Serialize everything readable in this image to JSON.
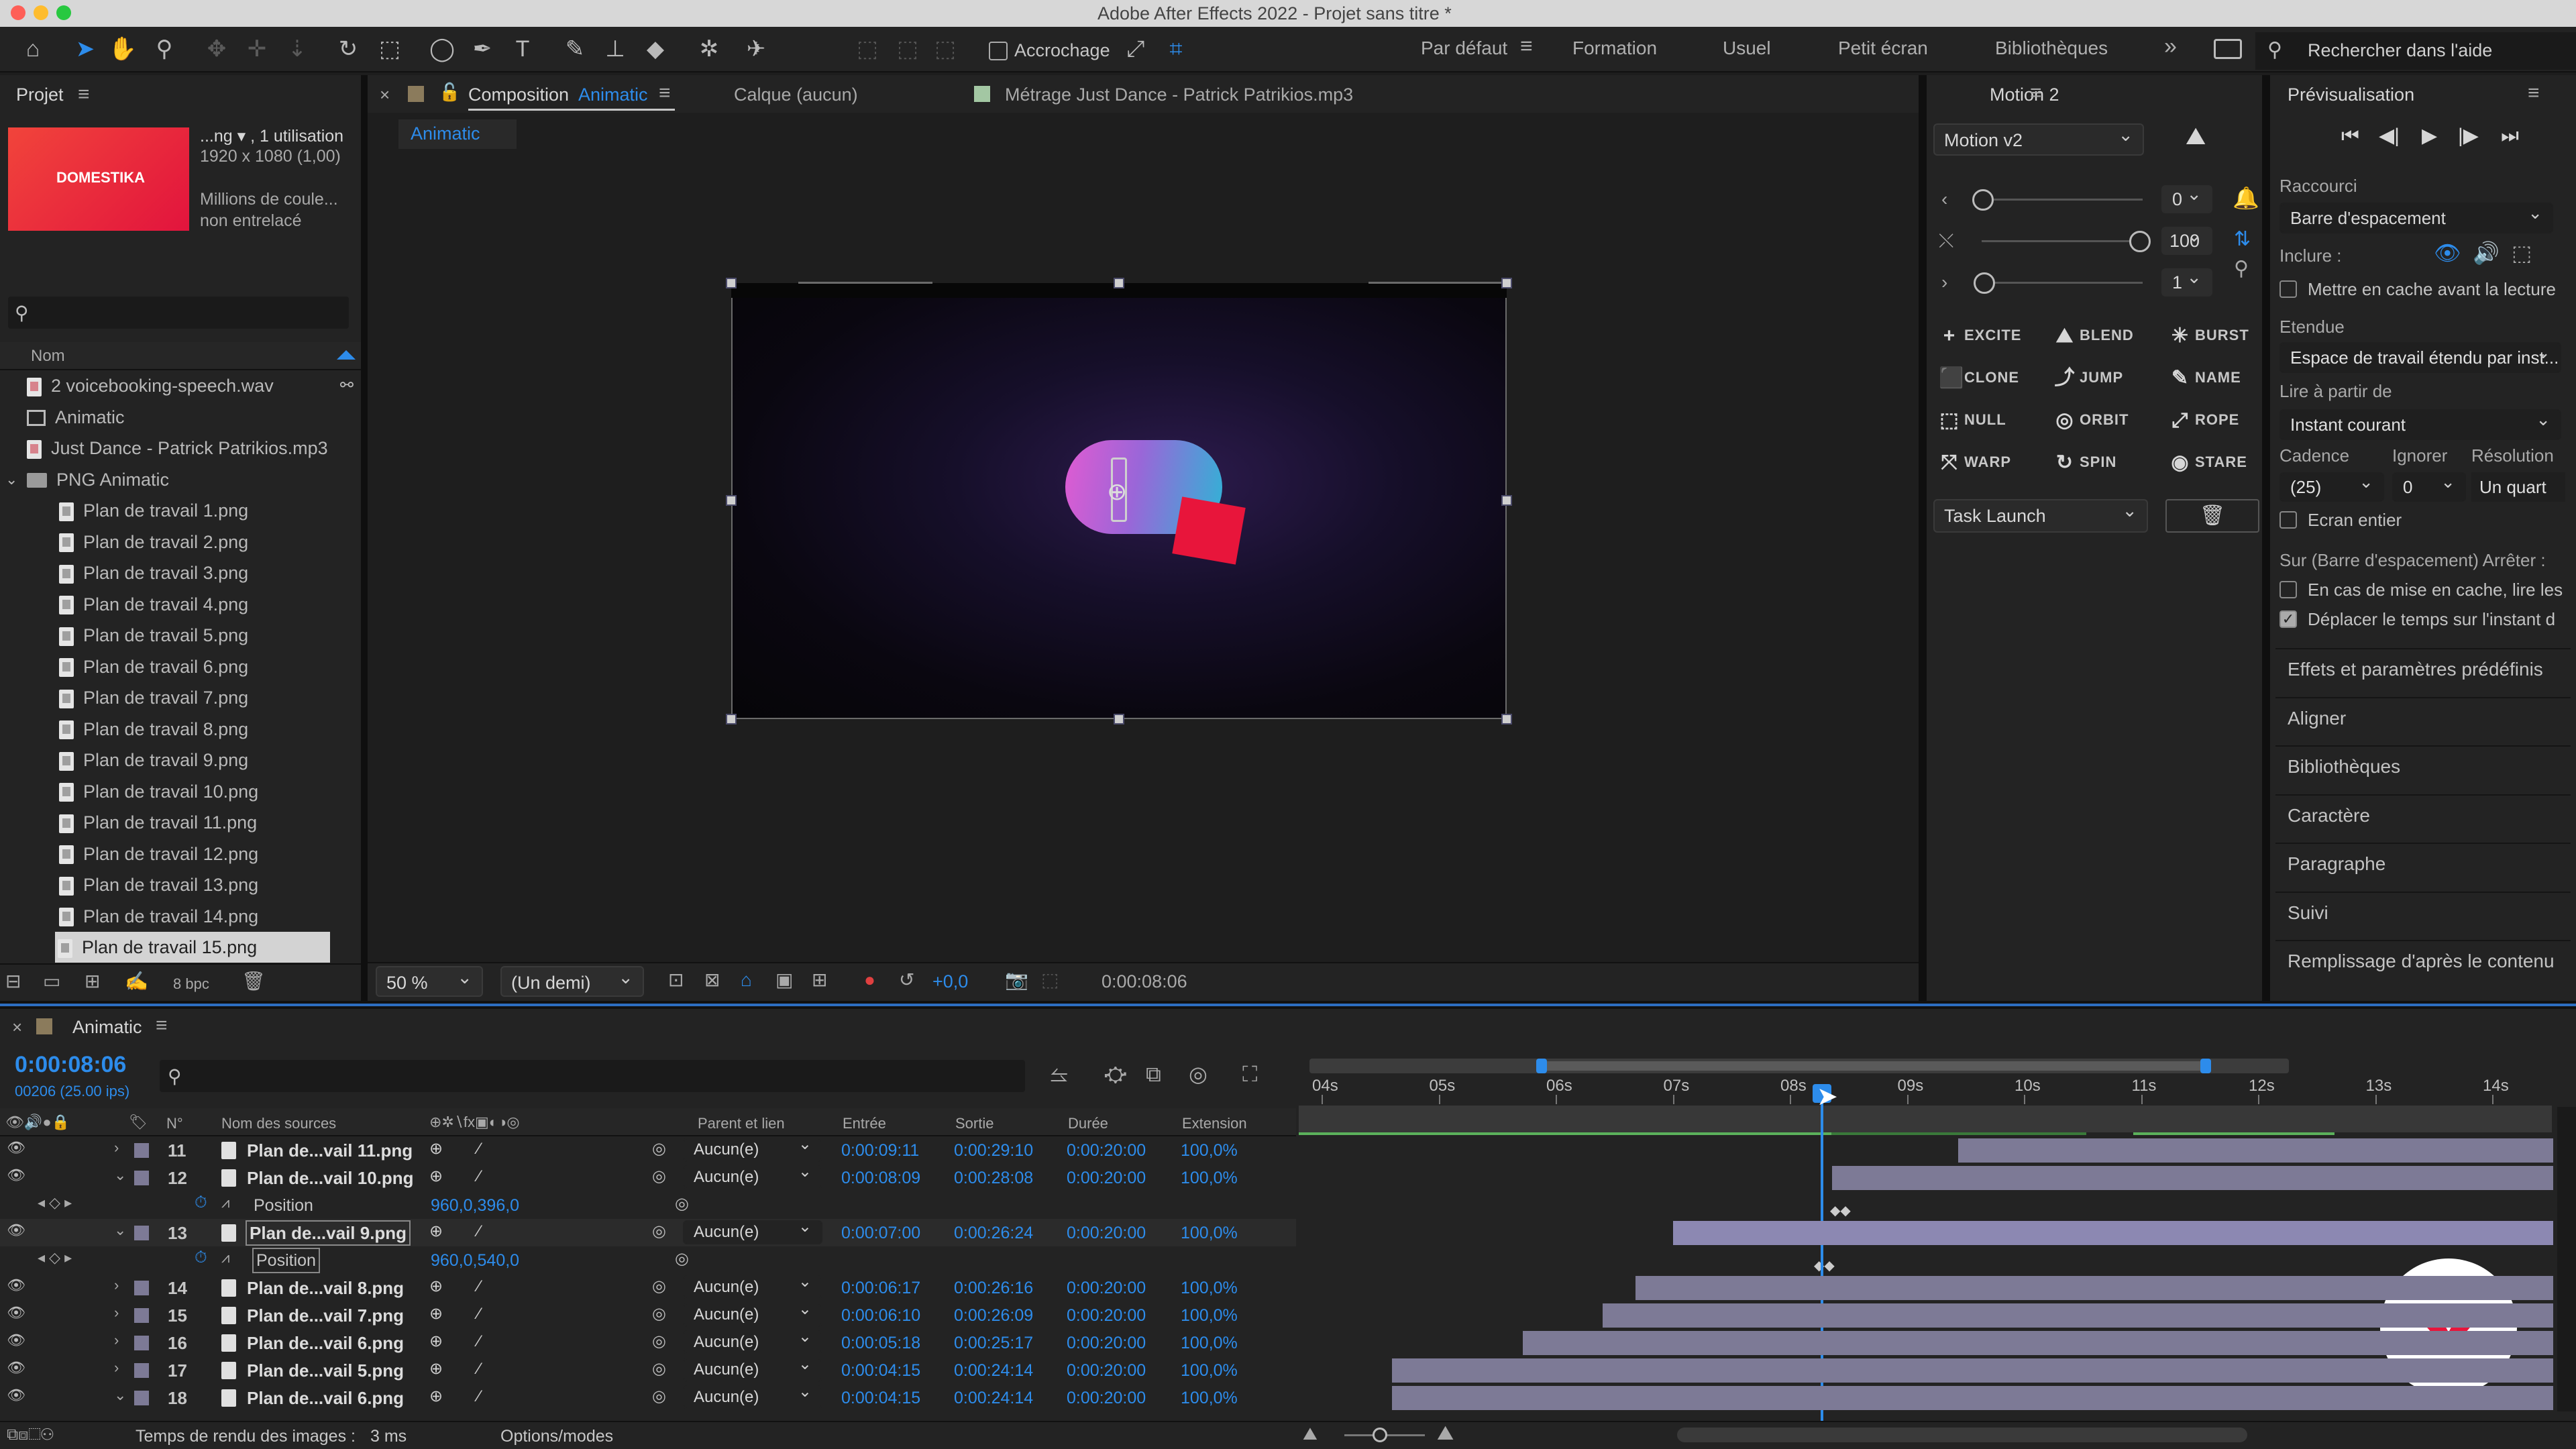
{
  "titlebar": {
    "title": "Adobe After Effects 2022 - Projet sans titre *"
  },
  "toolbar": {
    "snapping_label": "Accrochage",
    "search_placeholder": "Rechercher dans l'aide"
  },
  "workspaces": [
    {
      "label": "Par défaut",
      "active": true
    },
    {
      "label": "Formation"
    },
    {
      "label": "Usuel"
    },
    {
      "label": "Petit écran"
    },
    {
      "label": "Bibliothèques"
    }
  ],
  "project": {
    "title": "Projet",
    "info_name": "...ng ▾ , 1 utilisation",
    "info_size": "1920 x 1080 (1,00)",
    "info_colors": "Millions de coule...",
    "info_scan": "non entrelacé",
    "thumb_text": "DOMESTIKA",
    "column_name": "Nom",
    "items": [
      {
        "label": "2 voicebooking-speech.wav",
        "type": "audio",
        "indent": 0
      },
      {
        "label": "Animatic",
        "type": "comp",
        "indent": 0
      },
      {
        "label": "Just Dance - Patrick Patrikios.mp3",
        "type": "audio",
        "indent": 0
      },
      {
        "label": "PNG Animatic",
        "type": "folder",
        "indent": 0
      },
      {
        "label": "Plan de travail 1.png",
        "type": "png",
        "indent": 1
      },
      {
        "label": "Plan de travail 2.png",
        "type": "png",
        "indent": 1
      },
      {
        "label": "Plan de travail 3.png",
        "type": "png",
        "indent": 1
      },
      {
        "label": "Plan de travail 4.png",
        "type": "png",
        "indent": 1
      },
      {
        "label": "Plan de travail 5.png",
        "type": "png",
        "indent": 1
      },
      {
        "label": "Plan de travail 6.png",
        "type": "png",
        "indent": 1
      },
      {
        "label": "Plan de travail 7.png",
        "type": "png",
        "indent": 1
      },
      {
        "label": "Plan de travail 8.png",
        "type": "png",
        "indent": 1
      },
      {
        "label": "Plan de travail 9.png",
        "type": "png",
        "indent": 1
      },
      {
        "label": "Plan de travail 10.png",
        "type": "png",
        "indent": 1
      },
      {
        "label": "Plan de travail 11.png",
        "type": "png",
        "indent": 1
      },
      {
        "label": "Plan de travail 12.png",
        "type": "png",
        "indent": 1
      },
      {
        "label": "Plan de travail 13.png",
        "type": "png",
        "indent": 1
      },
      {
        "label": "Plan de travail 14.png",
        "type": "png",
        "indent": 1
      },
      {
        "label": "Plan de travail 15.png",
        "type": "png",
        "indent": 1,
        "selected": true
      }
    ],
    "bpc": "8 bpc"
  },
  "composition": {
    "tab_label": "Composition",
    "tab_name": "Animatic",
    "layer_tab": "Calque (aucun)",
    "footage_tab": "Métrage Just Dance - Patrick Patrikios.mp3",
    "breadcrumb": "Animatic",
    "zoom": "50 %",
    "resolution": "(Un demi)",
    "exposure": "+0,0",
    "timecode": "0:00:08:06"
  },
  "motion": {
    "title": "Motion 2",
    "preset": "Motion v2",
    "slider1_value": "0",
    "slider2_value": "100",
    "slider3_value": "1",
    "buttons": [
      {
        "label": "EXCITE",
        "icon": "+"
      },
      {
        "label": "BLEND",
        "icon": "⛰"
      },
      {
        "label": "BURST",
        "icon": "✳"
      },
      {
        "label": "CLONE",
        "icon": "⬛"
      },
      {
        "label": "JUMP",
        "icon": "⤴"
      },
      {
        "label": "NAME",
        "icon": "✎"
      },
      {
        "label": "NULL",
        "icon": "⬚"
      },
      {
        "label": "ORBIT",
        "icon": "◎"
      },
      {
        "label": "ROPE",
        "icon": "⤢"
      },
      {
        "label": "WARP",
        "icon": "⤧"
      },
      {
        "label": "SPIN",
        "icon": "↻"
      },
      {
        "label": "STARE",
        "icon": "◉"
      }
    ],
    "task": "Task Launch"
  },
  "preview": {
    "title": "Prévisualisation",
    "shortcut_label": "Raccourci",
    "shortcut_value": "Barre d'espacement",
    "include_label": "Inclure :",
    "cache_label": "Mettre en cache avant la lecture",
    "range_label": "Etendue",
    "range_value": "Espace de travail étendu par inst...",
    "play_from_label": "Lire à partir de",
    "play_from_value": "Instant courant",
    "cadence_label": "Cadence",
    "skip_label": "Ignorer",
    "resolution_label": "Résolution",
    "cadence_value": "(25)",
    "skip_value": "0",
    "resolution_value": "Un quart",
    "fullscreen_label": "Ecran entier",
    "on_stop_label": "Sur (Barre d'espacement) Arrêter :",
    "if_cached_label": "En cas de mise en cache, lire les",
    "move_time_label": "Déplacer le temps sur l'instant d"
  },
  "right_panels": [
    "Effets et paramètres prédéfinis",
    "Aligner",
    "Bibliothèques",
    "Caractère",
    "Paragraphe",
    "Suivi",
    "Remplissage d'après le contenu"
  ],
  "timeline": {
    "comp_tab": "Animatic",
    "timecode": "0:00:08:06",
    "frames": "00206 (25.00 ips)",
    "columns": {
      "num": "N°",
      "source": "Nom des sources",
      "parent": "Parent et lien",
      "in": "Entrée",
      "out": "Sortie",
      "duration": "Durée",
      "stretch": "Extension"
    },
    "ruler": [
      "04s",
      "05s",
      "06s",
      "07s",
      "08s",
      "09s",
      "10s",
      "11s",
      "12s",
      "13s",
      "14s"
    ],
    "layers": [
      {
        "num": "11",
        "name": "Plan de...vail 11.png",
        "parent": "Aucun(e)",
        "in": "0:00:09:11",
        "out": "0:00:29:10",
        "dur": "0:00:20:00",
        "stretch": "100,0%",
        "expanded": false,
        "bar_start_s": 9.44
      },
      {
        "num": "12",
        "name": "Plan de...vail 10.png",
        "parent": "Aucun(e)",
        "in": "0:00:08:09",
        "out": "0:00:28:08",
        "dur": "0:00:20:00",
        "stretch": "100,0%",
        "expanded": true,
        "bar_start_s": 8.36,
        "prop": {
          "name": "Position",
          "value": "960,0,396,0"
        }
      },
      {
        "num": "13",
        "name": "Plan de...vail 9.png",
        "parent": "Aucun(e)",
        "in": "0:00:07:00",
        "out": "0:00:26:24",
        "dur": "0:00:20:00",
        "stretch": "100,0%",
        "expanded": true,
        "selected": true,
        "bar_start_s": 7.0,
        "prop": {
          "name": "Position",
          "value": "960,0,540,0"
        }
      },
      {
        "num": "14",
        "name": "Plan de...vail 8.png",
        "parent": "Aucun(e)",
        "in": "0:00:06:17",
        "out": "0:00:26:16",
        "dur": "0:00:20:00",
        "stretch": "100,0%",
        "expanded": false,
        "bar_start_s": 6.68
      },
      {
        "num": "15",
        "name": "Plan de...vail 7.png",
        "parent": "Aucun(e)",
        "in": "0:00:06:10",
        "out": "0:00:26:09",
        "dur": "0:00:20:00",
        "stretch": "100,0%",
        "expanded": false,
        "bar_start_s": 6.4
      },
      {
        "num": "16",
        "name": "Plan de...vail 6.png",
        "parent": "Aucun(e)",
        "in": "0:00:05:18",
        "out": "0:00:25:17",
        "dur": "0:00:20:00",
        "stretch": "100,0%",
        "expanded": false,
        "bar_start_s": 5.72
      },
      {
        "num": "17",
        "name": "Plan de...vail 5.png",
        "parent": "Aucun(e)",
        "in": "0:00:04:15",
        "out": "0:00:24:14",
        "dur": "0:00:20:00",
        "stretch": "100,0%",
        "expanded": false,
        "bar_start_s": 4.6
      },
      {
        "num": "18",
        "name": "Plan de...vail 6.png",
        "parent": "Aucun(e)",
        "in": "0:00:04:15",
        "out": "0:00:24:14",
        "dur": "0:00:20:00",
        "stretch": "100,0%",
        "expanded": true,
        "bar_start_s": 4.6
      }
    ],
    "status_render": "Temps de rendu des images :",
    "status_value": "3 ms",
    "options_label": "Options/modes"
  },
  "colors": {
    "accent": "#2d8ceb",
    "label_lavender": "#7d7a96",
    "brand": "#e8153b"
  }
}
